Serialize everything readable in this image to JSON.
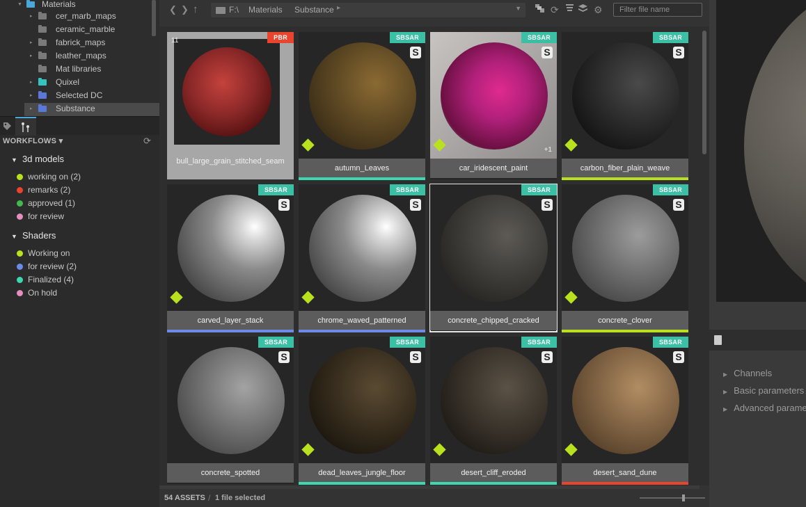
{
  "tree": {
    "root": {
      "label": "Materials",
      "color": "#4aa7d9"
    },
    "items": [
      {
        "label": "cer_marb_maps",
        "color": "#7a7a7a",
        "arrow": true
      },
      {
        "label": "ceramic_marble",
        "color": "#7a7a7a",
        "arrow": false
      },
      {
        "label": "fabrick_maps",
        "color": "#7a7a7a",
        "arrow": true
      },
      {
        "label": "leather_maps",
        "color": "#7a7a7a",
        "arrow": true
      },
      {
        "label": "Mat libraries",
        "color": "#7a7a7a",
        "arrow": false
      },
      {
        "label": "Quixel",
        "color": "#35c3c0",
        "arrow": true
      },
      {
        "label": "Selected DC",
        "color": "#5b78d8",
        "arrow": true
      },
      {
        "label": "Substance",
        "color": "#5b78d8",
        "arrow": true
      }
    ]
  },
  "workflows": {
    "title": "WORKFLOWS ▾",
    "groups": [
      {
        "label": "3d models",
        "items": [
          {
            "label": "working on  (2)",
            "color": "#b9e11e"
          },
          {
            "label": "remarks  (2)",
            "color": "#e8442e"
          },
          {
            "label": "approved  (1)",
            "color": "#41b94f"
          },
          {
            "label": "for review",
            "color": "#e48ec1"
          }
        ]
      },
      {
        "label": "Shaders",
        "items": [
          {
            "label": "Working on",
            "color": "#b9e11e"
          },
          {
            "label": "for review  (2)",
            "color": "#6b8be6"
          },
          {
            "label": "Finalized  (4)",
            "color": "#3ed7b1"
          },
          {
            "label": "On hold",
            "color": "#e48ec1"
          }
        ]
      }
    ]
  },
  "toolbar": {
    "path": [
      "F:\\",
      "Materials",
      "Substance"
    ],
    "filter_placeholder": "Filter file name"
  },
  "assets": [
    {
      "name": "bull_large_grain_stitched_seam",
      "badge": "PBR",
      "badge_color": "#e8442e",
      "kind": "ball",
      "c1": "#c4423c",
      "c2": "#4a0c0c",
      "stripe": "",
      "count": "11",
      "diamond": false,
      "selected": "light"
    },
    {
      "name": "autumn_Leaves",
      "badge": "SBSAR",
      "badge_color": "#3bbfa5",
      "kind": "sphere",
      "c1": "#8a6a33",
      "c2": "#2d2312",
      "stripe": "#3ed7b1",
      "diamond": true
    },
    {
      "name": "car_iridescent_paint",
      "badge": "SBSAR",
      "badge_color": "#3bbfa5",
      "kind": "glass",
      "c1": "#e02a8f",
      "c2": "#6b1042",
      "stripe": "",
      "extra": "+1",
      "diamond": true
    },
    {
      "name": "carbon_fiber_plain_weave",
      "badge": "SBSAR",
      "badge_color": "#3bbfa5",
      "kind": "sphere",
      "c1": "#4a4a4a",
      "c2": "#0a0a0a",
      "stripe": "#b9e11e",
      "diamond": true
    },
    {
      "name": "carved_layer_stack",
      "badge": "SBSAR",
      "badge_color": "#3bbfa5",
      "kind": "chrome",
      "c1": "#d8d8d8",
      "c2": "#2f2f2f",
      "stripe": "#6b8be6",
      "diamond": true
    },
    {
      "name": "chrome_waved_patterned",
      "badge": "SBSAR",
      "badge_color": "#3bbfa5",
      "kind": "chrome",
      "c1": "#d8d8d8",
      "c2": "#2f2f2f",
      "stripe": "#6b8be6",
      "diamond": true
    },
    {
      "name": "concrete_chipped_cracked",
      "badge": "SBSAR",
      "badge_color": "#3bbfa5",
      "kind": "sphere",
      "c1": "#5d5a55",
      "c2": "#1e1d1b",
      "stripe": "",
      "diamond": false,
      "selected": "white"
    },
    {
      "name": "concrete_clover",
      "badge": "SBSAR",
      "badge_color": "#3bbfa5",
      "kind": "sphere",
      "c1": "#9c9c9c",
      "c2": "#3a3a3a",
      "stripe": "#b9e11e",
      "diamond": true
    },
    {
      "name": "concrete_spotted",
      "badge": "SBSAR",
      "badge_color": "#3bbfa5",
      "kind": "sphere",
      "c1": "#a3a3a3",
      "c2": "#3c3c3c",
      "stripe": "",
      "diamond": false
    },
    {
      "name": "dead_leaves_jungle_floor",
      "badge": "SBSAR",
      "badge_color": "#3bbfa5",
      "kind": "sphere",
      "c1": "#5a4a32",
      "c2": "#120e08",
      "stripe": "#3ed7b1",
      "diamond": true
    },
    {
      "name": "desert_cliff_eroded",
      "badge": "SBSAR",
      "badge_color": "#3bbfa5",
      "kind": "sphere",
      "c1": "#5b5246",
      "c2": "#15120e",
      "stripe": "#3ed7b1",
      "diamond": true
    },
    {
      "name": "desert_sand_dune",
      "badge": "SBSAR",
      "badge_color": "#3bbfa5",
      "kind": "sphere",
      "c1": "#b28d63",
      "c2": "#4a3622",
      "stripe": "#e8442e",
      "diamond": true
    }
  ],
  "status": {
    "assets": "54 ASSETS",
    "sep": "/",
    "selected": "1 file selected"
  },
  "zoom": 0.68,
  "right": {
    "sections": [
      "Channels",
      "Basic parameters",
      "Advanced parame"
    ]
  }
}
